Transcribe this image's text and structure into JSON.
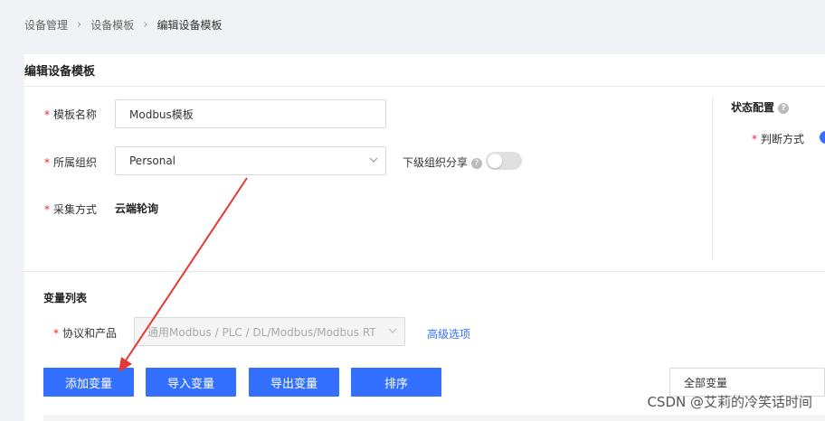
{
  "breadcrumb": {
    "items": [
      "设备管理",
      "设备模板",
      "编辑设备模板"
    ],
    "separator": ">"
  },
  "page_title": "编辑设备模板",
  "form": {
    "required_mark": "*",
    "template_name": {
      "label": "模板名称",
      "value": "Modbus模板"
    },
    "organization": {
      "label": "所属组织",
      "value": "Personal"
    },
    "sub_org_share": {
      "label": "下级组织分享",
      "enabled": false
    },
    "collect_method": {
      "label": "采集方式",
      "value": "云端轮询"
    }
  },
  "status_config": {
    "title": "状态配置",
    "judge_method_label": "判断方式"
  },
  "variable_list": {
    "title": "变量列表",
    "protocol_label": "协议和产品",
    "protocol_value": "通用Modbus / PLC / DL/Modbus/Modbus RT",
    "advanced_link": "高级选项",
    "buttons": {
      "add": "添加变量",
      "import": "导入变量",
      "export": "导出变量",
      "sort": "排序"
    },
    "filter_value": "全部变量"
  },
  "watermark": "CSDN @艾莉的冷笑话时间",
  "colors": {
    "primary": "#3370ff",
    "required": "#f5222d",
    "annotation_arrow": "#e53935"
  },
  "help_icon_glyph": "?"
}
